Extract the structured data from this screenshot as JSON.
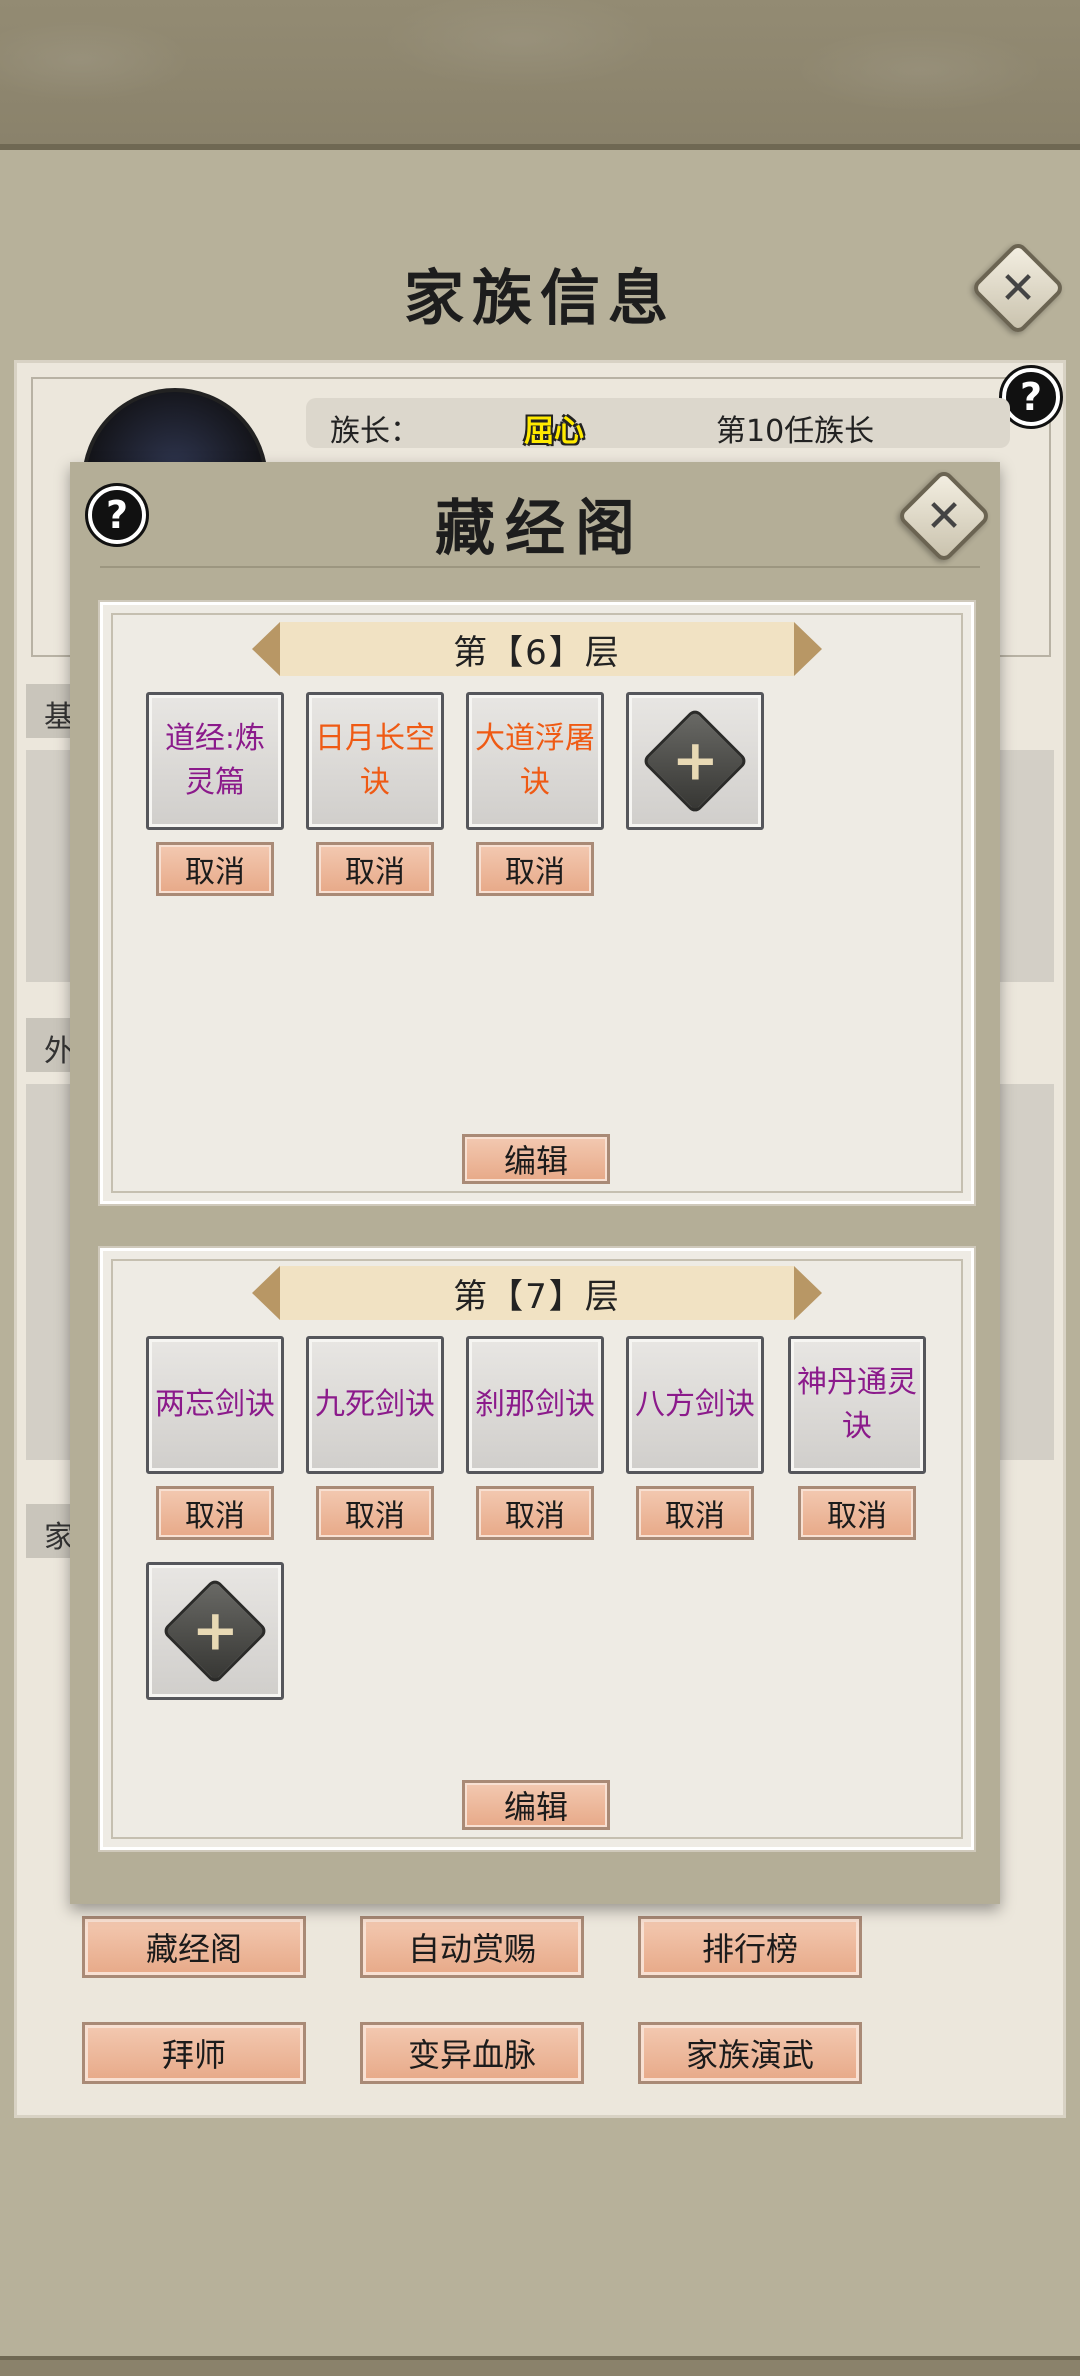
{
  "header": {
    "title": "家族信息"
  },
  "leader": {
    "label": "族长：",
    "name": "屈心",
    "rank": "第10任族长"
  },
  "side_tabs": [
    "基",
    "外",
    "家"
  ],
  "base_buttons": [
    {
      "label": "藏经阁"
    },
    {
      "label": "自动赏赐"
    },
    {
      "label": "排行榜"
    },
    {
      "label": "拜师"
    },
    {
      "label": "变异血脉"
    },
    {
      "label": "家族演武"
    }
  ],
  "modal": {
    "title": "藏经阁",
    "floors": [
      {
        "title": "第【6】层",
        "slots": [
          {
            "text": "道经:炼灵篇",
            "color": "purple"
          },
          {
            "text": "日月长空诀",
            "color": "orange"
          },
          {
            "text": "大道浮屠诀",
            "color": "orange"
          }
        ],
        "cancel_label": "取消",
        "edit_label": "编辑"
      },
      {
        "title": "第【7】层",
        "slots": [
          {
            "text": "两忘剑诀",
            "color": "purple"
          },
          {
            "text": "九死剑诀",
            "color": "purple"
          },
          {
            "text": "刹那剑诀",
            "color": "purple"
          },
          {
            "text": "八方剑诀",
            "color": "purple"
          },
          {
            "text": "神丹通灵诀",
            "color": "purple"
          }
        ],
        "cancel_label": "取消",
        "edit_label": "编辑"
      }
    ]
  },
  "icons": {
    "close": "close-icon",
    "help": "help-icon",
    "add": "add-skill-icon"
  },
  "colors": {
    "purple": "#8b1a8b",
    "orange": "#ef5a14",
    "leader_name": "#ffea00"
  }
}
